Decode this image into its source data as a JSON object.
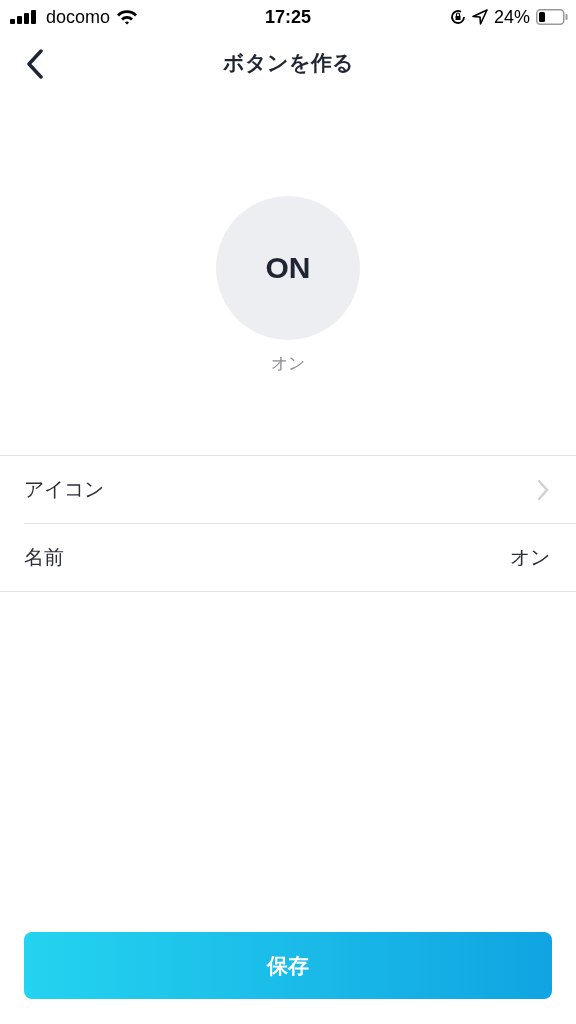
{
  "status_bar": {
    "carrier": "docomo",
    "time": "17:25",
    "battery": "24%"
  },
  "nav": {
    "title": "ボタンを作る"
  },
  "preview": {
    "icon_text": "ON",
    "label": "オン"
  },
  "rows": [
    {
      "kind": "link",
      "label": "アイコン"
    },
    {
      "kind": "value",
      "label": "名前",
      "value": "オン"
    }
  ],
  "save_button": "保存"
}
